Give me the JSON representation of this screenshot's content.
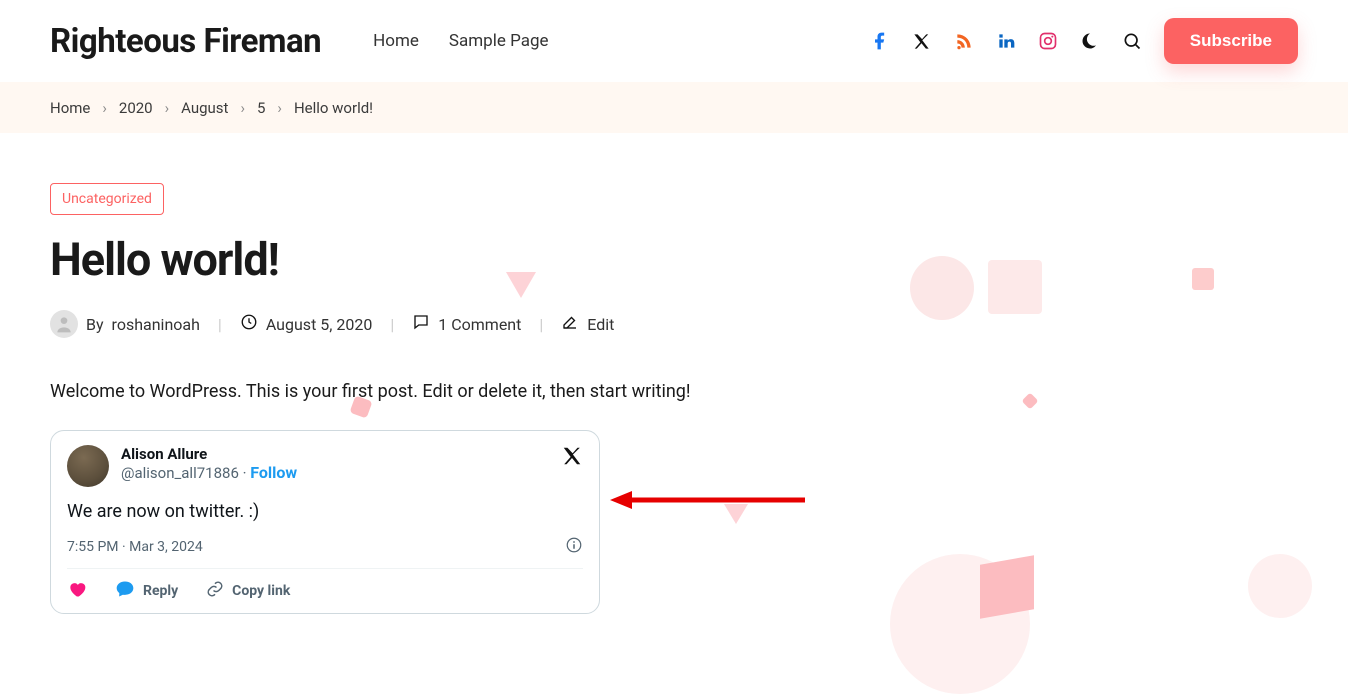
{
  "header": {
    "site_title": "Righteous Fireman",
    "nav": [
      {
        "label": "Home"
      },
      {
        "label": "Sample Page"
      }
    ],
    "subscribe_label": "Subscribe"
  },
  "breadcrumbs": [
    {
      "label": "Home"
    },
    {
      "label": "2020"
    },
    {
      "label": "August"
    },
    {
      "label": "5"
    },
    {
      "label": "Hello world!"
    }
  ],
  "post": {
    "category": "Uncategorized",
    "title": "Hello world!",
    "author_prefix": "By",
    "author": "roshaninoah",
    "date": "August 5, 2020",
    "comments": "1 Comment",
    "edit": "Edit",
    "body": "Welcome to WordPress. This is your first post. Edit or delete it, then start writing!"
  },
  "tweet": {
    "name": "Alison Allure",
    "handle": "@alison_all71886",
    "sep": " · ",
    "follow": "Follow",
    "text": "We are now on twitter. :)",
    "time": "7:55 PM · Mar 3, 2024",
    "reply": "Reply",
    "copylink": "Copy link"
  },
  "colors": {
    "accent": "#fc6262",
    "facebook": "#1877f2",
    "rss": "#f26522",
    "linkedin": "#0a66c2",
    "instagram": "#e1306c",
    "twitter_blue": "#1d9bf0",
    "twitter_pink": "#f91880"
  }
}
